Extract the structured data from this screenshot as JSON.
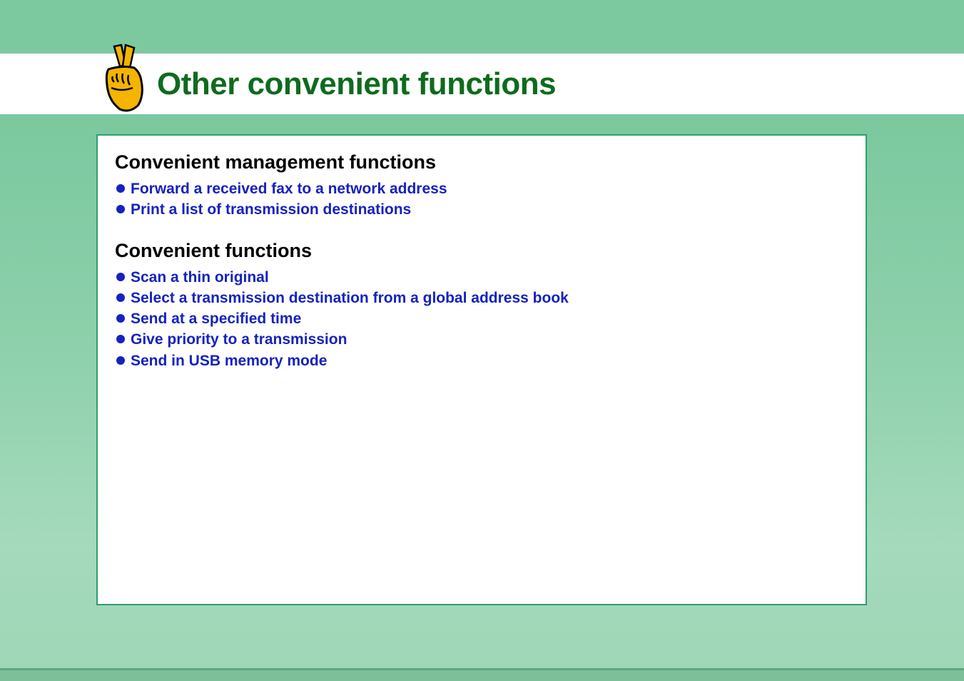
{
  "header": {
    "title": "Other convenient functions",
    "icon_name": "peace-hand-icon"
  },
  "sections": [
    {
      "heading": "Convenient management functions",
      "items": [
        "Forward a received fax to a network address",
        "Print a list of transmission destinations"
      ]
    },
    {
      "heading": "Convenient functions",
      "items": [
        "Scan a thin original",
        "Select a transmission destination from a global address book",
        "Send at a specified time",
        "Give priority to a transmission",
        "Send in USB memory mode"
      ]
    }
  ]
}
